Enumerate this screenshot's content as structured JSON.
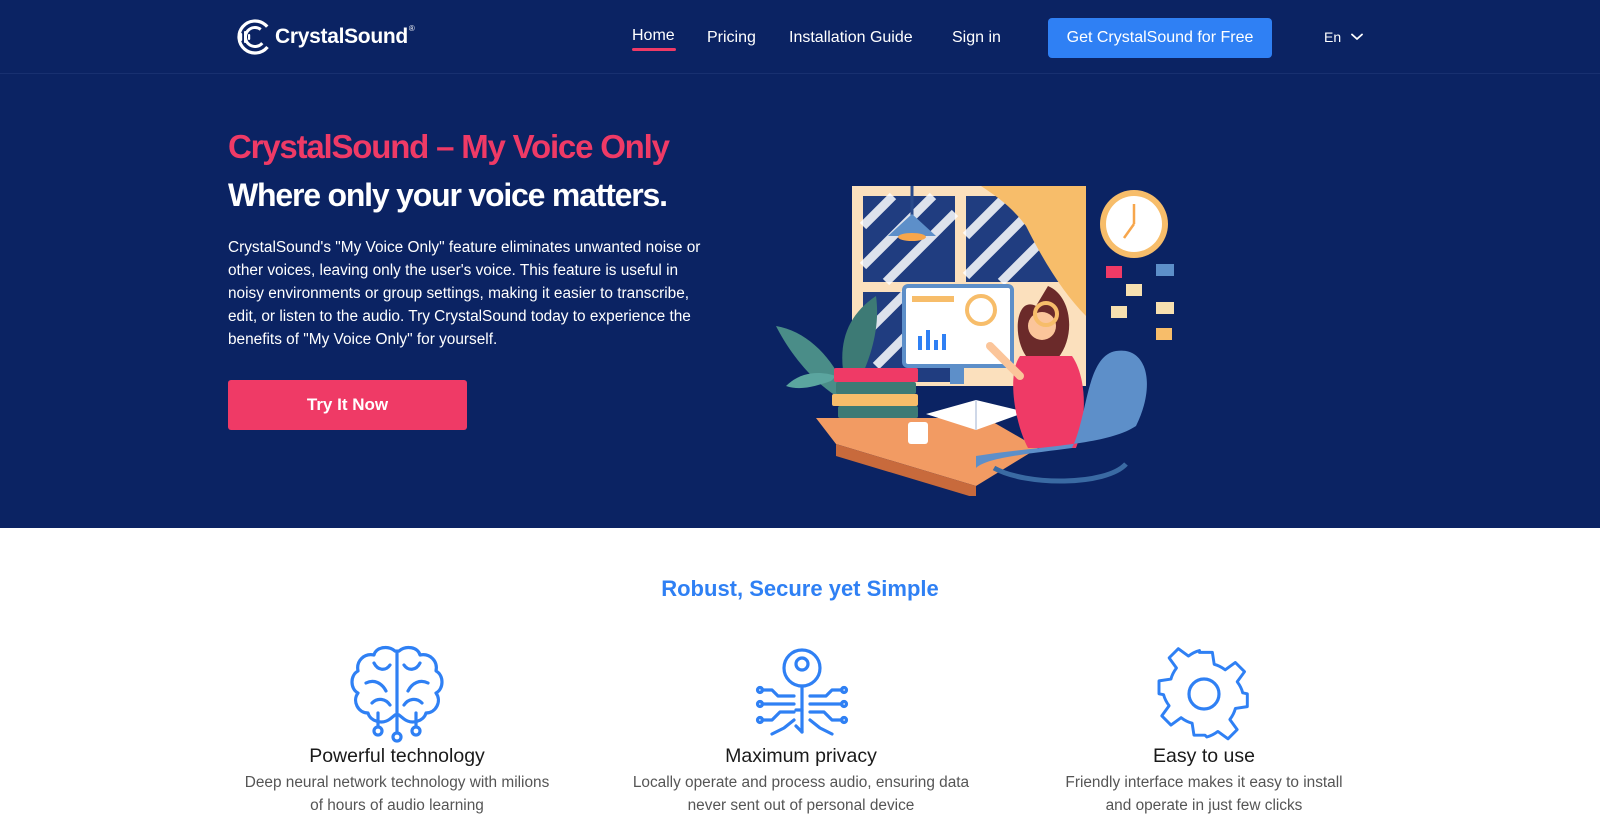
{
  "brand": {
    "name": "CrystalSound",
    "registered": "®",
    "logo_icon": "crystalsound-logo-icon"
  },
  "nav": {
    "items": [
      {
        "label": "Home",
        "active": true
      },
      {
        "label": "Pricing"
      },
      {
        "label": "Installation Guide"
      },
      {
        "label": "Sign in"
      }
    ],
    "cta_label": "Get CrystalSound for Free",
    "language": "En"
  },
  "hero": {
    "title": "CrystalSound – My Voice Only",
    "subtitle": "Where only your voice matters.",
    "description": "CrystalSound's \"My Voice Only\" feature eliminates unwanted noise or other voices, leaving only the user's voice. This feature is useful in noisy environments or group settings, making it easier to transcribe, edit, or listen to the audio. Try CrystalSound today to experience the benefits of \"My Voice Only\" for yourself.",
    "button_label": "Try It Now",
    "illustration": "woman-with-headphones-at-desk-illustration"
  },
  "features": {
    "heading": "Robust, Secure yet Simple",
    "items": [
      {
        "icon": "brain-circuit-icon",
        "title": "Powerful technology",
        "desc_line1": "Deep neural network technology with milions",
        "desc_line2": "of hours of audio learning"
      },
      {
        "icon": "key-circuit-icon",
        "title": "Maximum privacy",
        "desc_line1": "Locally operate and process audio, ensuring data",
        "desc_line2": "never sent out of personal device"
      },
      {
        "icon": "gear-icon",
        "title": "Easy to use",
        "desc_line1": "Friendly interface makes it easy to install",
        "desc_line2": "and operate in just few clicks"
      }
    ]
  },
  "colors": {
    "hero_bg": "#0b2363",
    "accent_pink": "#ef3a66",
    "accent_blue": "#2f80f4"
  }
}
